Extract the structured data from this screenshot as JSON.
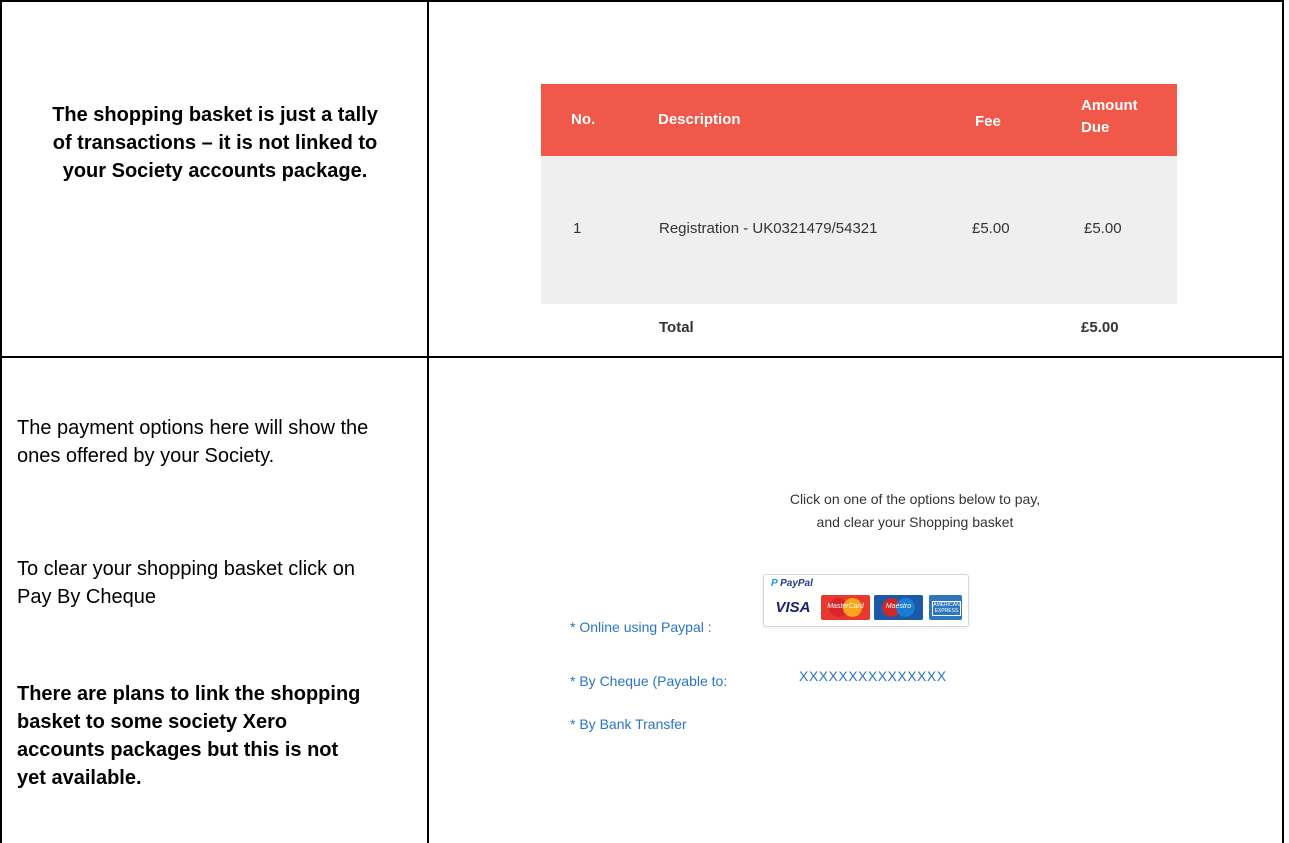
{
  "notes": {
    "basket_note": "The shopping basket is just a tally of transactions – it is not linked to your Society accounts package.",
    "payment_note_1": "The payment options here will show the ones offered by your Society.",
    "payment_note_2": "To clear your shopping basket click on Pay By Cheque",
    "payment_note_3": "There are plans to link the shopping basket to some society Xero accounts packages but this is not yet available."
  },
  "basket": {
    "headers": {
      "no": "No.",
      "description": "Description",
      "fee": "Fee",
      "amount_due_1": "Amount",
      "amount_due_2": "Due"
    },
    "rows": [
      {
        "no": "1",
        "description": "Registration - UK0321479/54321",
        "fee": "£5.00",
        "amount_due": "£5.00"
      }
    ],
    "total_label": "Total",
    "total_value": "£5.00",
    "header_color": "#f0584a"
  },
  "payment": {
    "intro_line_1": "Click on one of the options below to pay,",
    "intro_line_2": "and clear your Shopping basket",
    "paypal_label": "* Online using Paypal :",
    "paypal_logo": "PayPal",
    "visa_label": "VISA",
    "mastercard_label": "MasterCard",
    "maestro_label": "Maestro",
    "amex_label": "AMERICAN EXPRESS",
    "cheque_label": "* By Cheque (Payable to:",
    "cheque_payee": "XXXXXXXXXXXXXXX",
    "bank_label": "* By Bank Transfer",
    "link_color": "#2a74c9"
  }
}
